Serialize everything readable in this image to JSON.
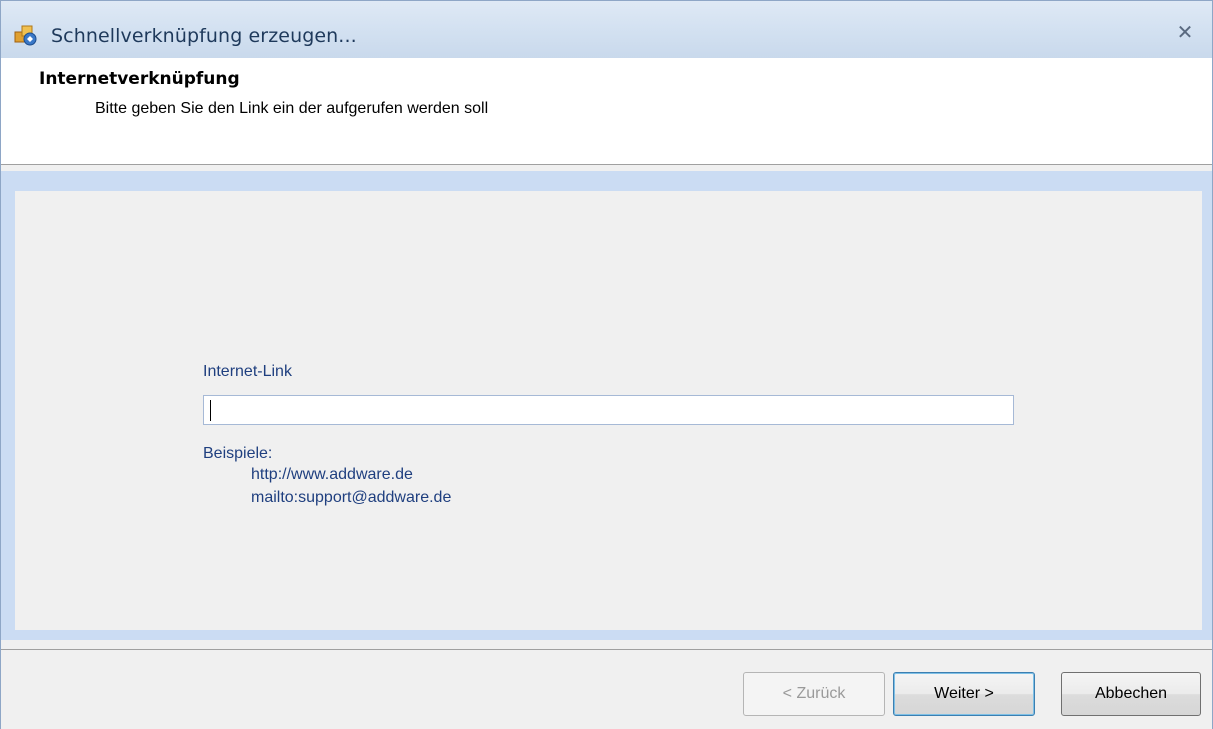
{
  "window": {
    "title": "Schnellverknüpfung erzeugen...",
    "close_glyph": "✕",
    "app_icon": "shortcut-app-icon"
  },
  "header": {
    "title": "Internetverknüpfung",
    "subtitle": "Bitte geben Sie den Link ein der aufgerufen werden soll"
  },
  "form": {
    "link_label": "Internet-Link",
    "link_value": "",
    "examples_label": "Beispiele:",
    "examples": [
      "http://www.addware.de",
      "mailto:support@addware.de"
    ]
  },
  "buttons": {
    "back": "< Zurück",
    "next": "Weiter >",
    "cancel": "Abbechen"
  },
  "colors": {
    "frame_blue": "#cbdcf3",
    "label_blue": "#1f3f7f",
    "default_button_border": "#3c7fb1"
  }
}
